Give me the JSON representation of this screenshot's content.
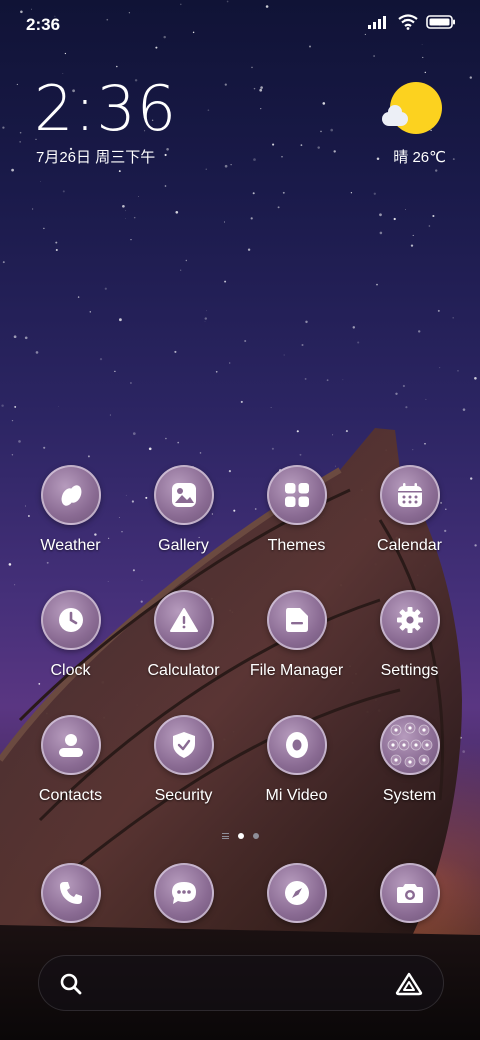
{
  "status_bar": {
    "time": "2:36",
    "icons": [
      "signal-icon",
      "wifi-icon",
      "battery-icon"
    ]
  },
  "clock_widget": {
    "time": "2:36",
    "date": "7月26日 周三下午"
  },
  "weather_widget": {
    "condition_icon": "sun-cloud-icon",
    "text": "晴 26℃"
  },
  "apps": [
    {
      "label": "Weather",
      "icon": "weather-icon"
    },
    {
      "label": "Gallery",
      "icon": "gallery-icon"
    },
    {
      "label": "Themes",
      "icon": "themes-icon"
    },
    {
      "label": "Calendar",
      "icon": "calendar-icon"
    },
    {
      "label": "Clock",
      "icon": "clock-icon"
    },
    {
      "label": "Calculator",
      "icon": "calculator-icon"
    },
    {
      "label": "File Manager",
      "icon": "file-manager-icon"
    },
    {
      "label": "Settings",
      "icon": "settings-icon"
    },
    {
      "label": "Contacts",
      "icon": "contacts-icon"
    },
    {
      "label": "Security",
      "icon": "security-icon"
    },
    {
      "label": "Mi Video",
      "icon": "mi-video-icon"
    },
    {
      "label": "System",
      "icon": "system-folder-icon"
    }
  ],
  "dock": [
    {
      "icon": "phone-icon"
    },
    {
      "icon": "messages-icon"
    },
    {
      "icon": "browser-icon"
    },
    {
      "icon": "camera-icon"
    }
  ],
  "page_indicator": {
    "pages": 2,
    "current": 1
  },
  "search_bar": {
    "left_icon": "search-icon",
    "right_icon": "assistant-icon"
  },
  "colors": {
    "icon_bg": "#8a6b93",
    "sun": "#fcd21f"
  }
}
